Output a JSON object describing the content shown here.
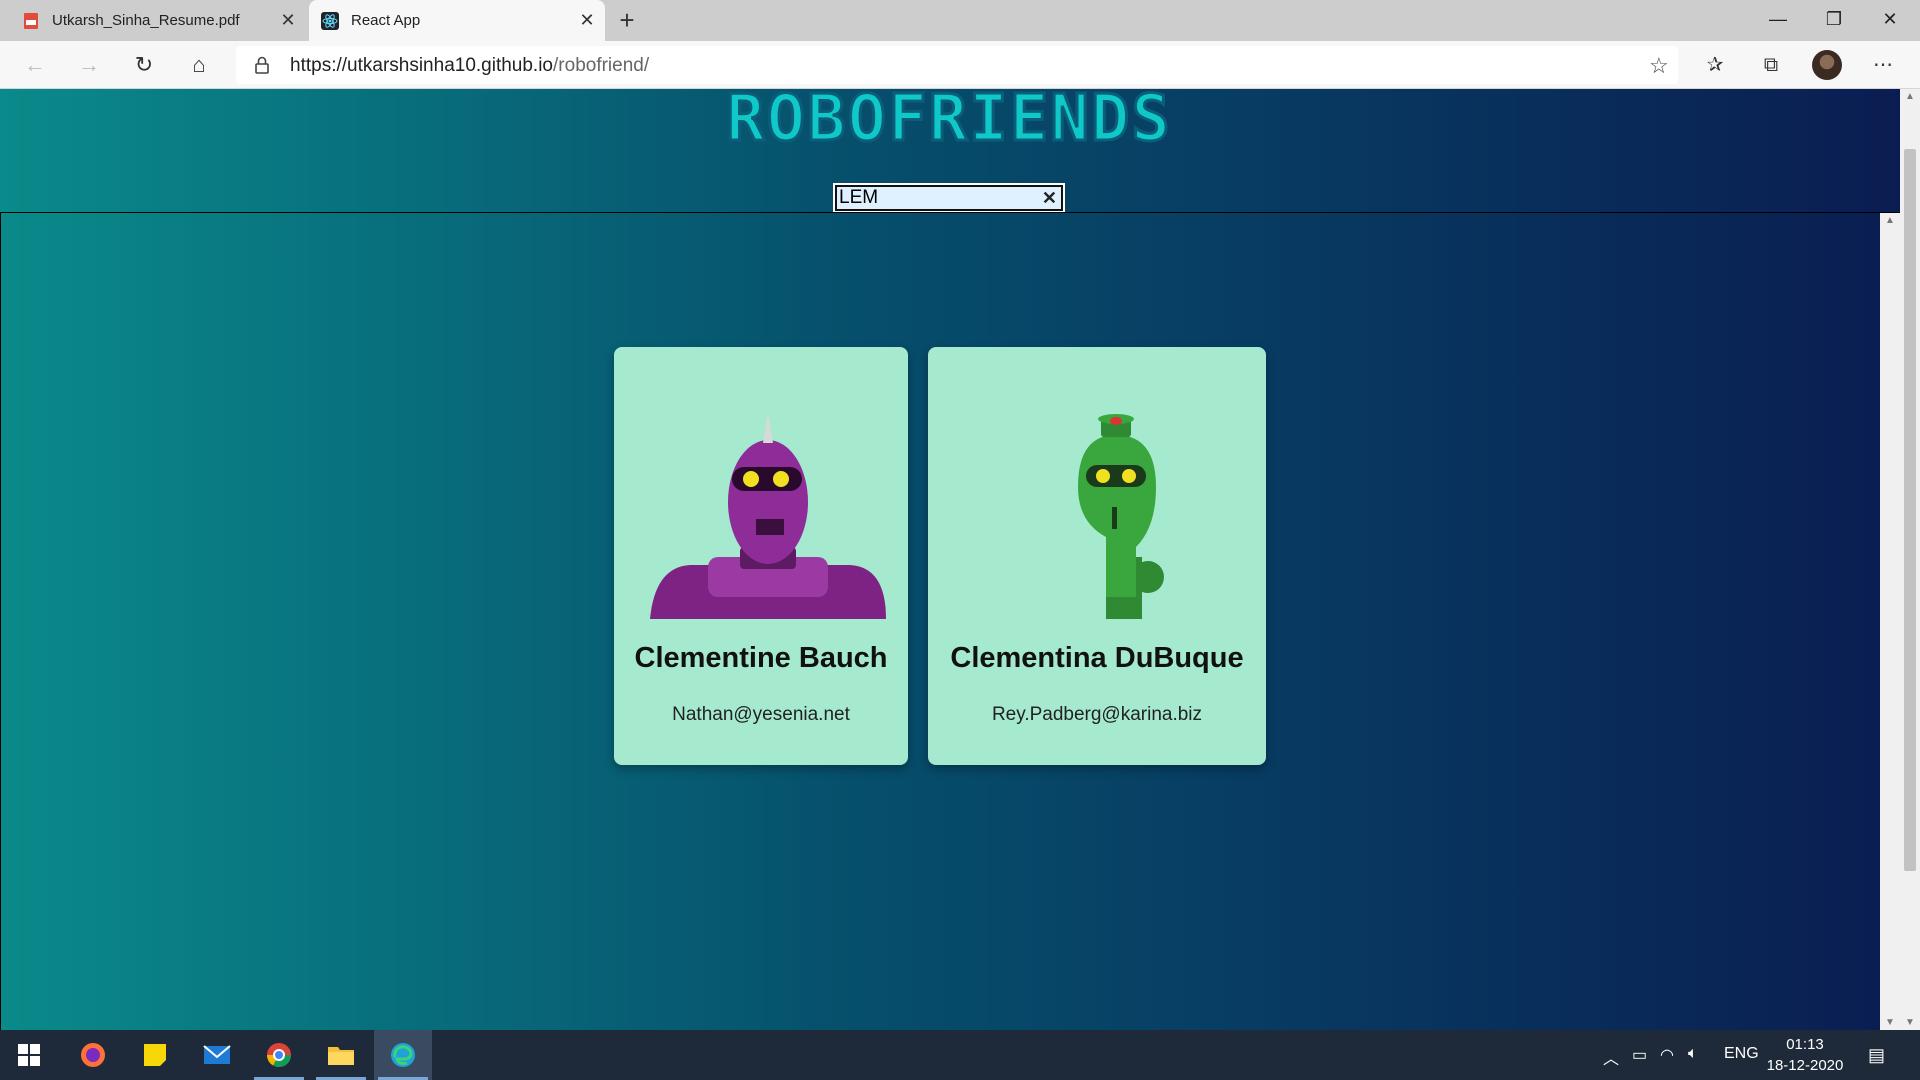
{
  "browser": {
    "tabs": [
      {
        "title": "Utkarsh_Sinha_Resume.pdf",
        "icon": "pdf-icon"
      },
      {
        "title": "React App",
        "icon": "react-icon"
      }
    ],
    "url": {
      "host": "https://utkarshsinha10.github.io",
      "path": "/robofriend/"
    }
  },
  "app": {
    "title": "ROBOFRIENDS",
    "search": {
      "value": "LEM",
      "placeholder": "search robots"
    },
    "cards": [
      {
        "name": "Clementine Bauch",
        "email": "Nathan@yesenia.net",
        "robot_color": "#8e2c98"
      },
      {
        "name": "Clementina DuBuque",
        "email": "Rey.Padberg@karina.biz",
        "robot_color": "#3aa63e"
      }
    ]
  },
  "taskbar": {
    "items": [
      "windows-start-icon",
      "firefox-icon",
      "sticky-notes-icon",
      "mail-icon",
      "chrome-icon",
      "file-explorer-icon",
      "edge-icon"
    ],
    "language": "ENG",
    "time": "01:13",
    "date": "18-12-2020"
  },
  "colors": {
    "page_gradient_start": "#0a8a8a",
    "page_gradient_end": "#0a1d52",
    "card_bg": "#a5eacf",
    "title_color": "#0fc9c9"
  }
}
